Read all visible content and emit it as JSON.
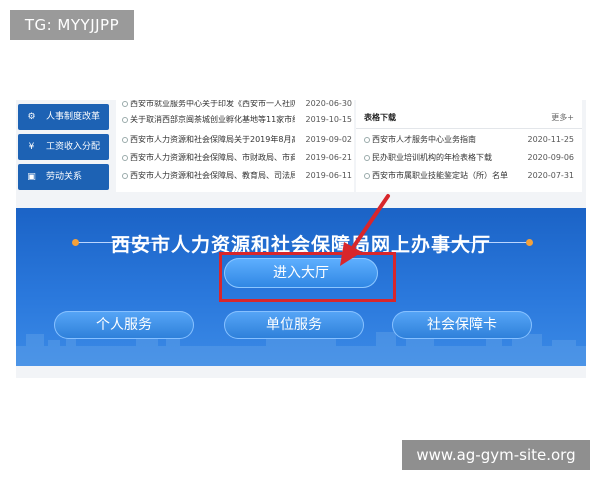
{
  "overlay": {
    "tg_label": "TG: MYYJJPP",
    "watermark": "www.ag-gym-site.org"
  },
  "sidebar": {
    "items": [
      {
        "label": "人事制度改革",
        "icon": "gear-icon"
      },
      {
        "label": "工资收入分配",
        "icon": "yen-icon"
      },
      {
        "label": "劳动关系",
        "icon": "document-icon"
      }
    ]
  },
  "news": {
    "rows": [
      {
        "title": "西安市就业服务中心关于印发《西安市一人社防…",
        "date": "2020-06-30"
      },
      {
        "title": "关于取消西部京闽茶城创业孵化基地等11家市级…",
        "date": "2019-10-15"
      },
      {
        "title": "西安市人力资源和社会保障局关于2019年8月高…",
        "date": "2019-09-02"
      },
      {
        "title": "西安市人力资源和社会保障局、市财政局、市商…",
        "date": "2019-06-21"
      },
      {
        "title": "西安市人力资源和社会保障局、教育局、司法局…",
        "date": "2019-06-11"
      }
    ]
  },
  "forms": {
    "title": "表格下载",
    "more": "更多+",
    "rows": [
      {
        "title": "西安市人才服务中心业务指南",
        "date": "2020-11-25"
      },
      {
        "title": "民办职业培训机构的年检表格下载",
        "date": "2020-09-06"
      },
      {
        "title": "西安市市属职业技能鉴定站（所）名单",
        "date": "2020-07-31"
      }
    ]
  },
  "banner": {
    "title": "西安市人力资源和社会保障局网上办事大厅",
    "enter_button": "进入大厅",
    "services": [
      {
        "label": "个人服务"
      },
      {
        "label": "单位服务"
      },
      {
        "label": "社会保障卡"
      }
    ]
  },
  "colors": {
    "sidebar_blue": "#1d62b4",
    "banner_blue": "#2a78dc",
    "highlight_red": "#d8262b",
    "accent_orange": "#f4a13a"
  }
}
